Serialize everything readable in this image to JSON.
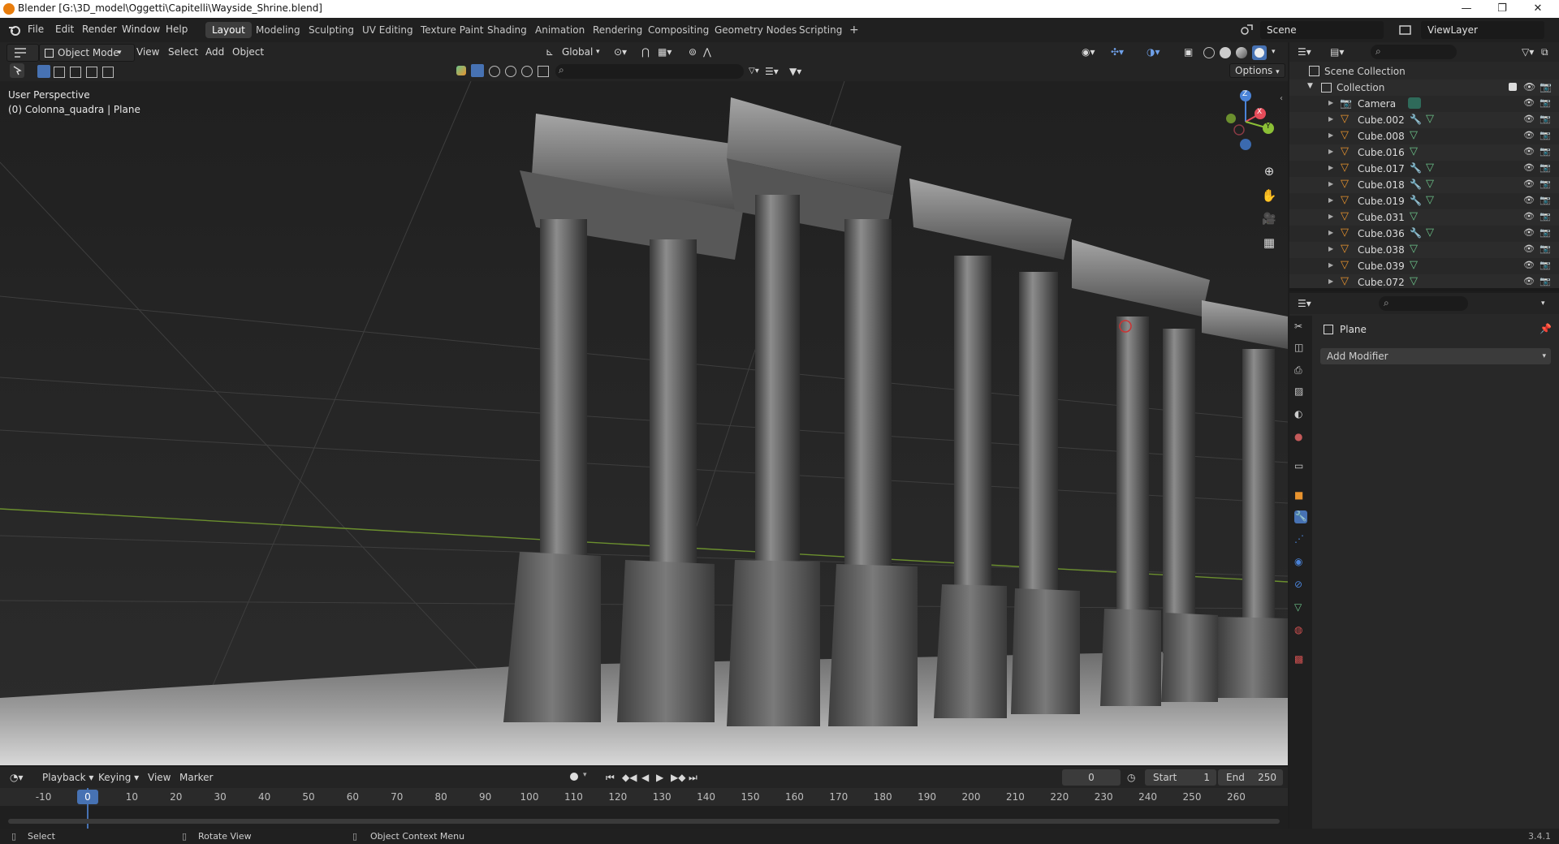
{
  "window": {
    "title": "Blender [G:\\3D_model\\Oggetti\\Capitelli\\Wayside_Shrine.blend]",
    "min_glyph": "—",
    "max_glyph": "❐",
    "close_glyph": "✕"
  },
  "menus": [
    "File",
    "Edit",
    "Render",
    "Window",
    "Help"
  ],
  "workspaces": [
    {
      "label": "Layout",
      "active": true
    },
    {
      "label": "Modeling"
    },
    {
      "label": "Sculpting"
    },
    {
      "label": "UV Editing"
    },
    {
      "label": "Texture Paint"
    },
    {
      "label": "Shading"
    },
    {
      "label": "Animation"
    },
    {
      "label": "Rendering"
    },
    {
      "label": "Compositing"
    },
    {
      "label": "Geometry Nodes"
    },
    {
      "label": "Scripting"
    }
  ],
  "add_workspace": "+",
  "scene": {
    "name": "Scene",
    "view_layer": "ViewLayer"
  },
  "viewport_header": {
    "mode": "Object Mode",
    "menus": [
      "View",
      "Select",
      "Add",
      "Object"
    ],
    "transform_orientation": "Global",
    "options": "Options"
  },
  "viewport": {
    "perspective": "User Perspective",
    "object_info": "(0) Colonna_quadra | Plane",
    "gizmo": {
      "x": "X",
      "y": "Y",
      "z": "Z"
    }
  },
  "outliner": {
    "root": "Scene Collection",
    "collection": "Collection",
    "items": [
      {
        "name": "Camera",
        "type": "camera",
        "modifier": false
      },
      {
        "name": "Cube.002",
        "type": "mesh",
        "modifier": true
      },
      {
        "name": "Cube.008",
        "type": "mesh",
        "modifier": false
      },
      {
        "name": "Cube.016",
        "type": "mesh",
        "modifier": false
      },
      {
        "name": "Cube.017",
        "type": "mesh",
        "modifier": true
      },
      {
        "name": "Cube.018",
        "type": "mesh",
        "modifier": true
      },
      {
        "name": "Cube.019",
        "type": "mesh",
        "modifier": true
      },
      {
        "name": "Cube.031",
        "type": "mesh",
        "modifier": false
      },
      {
        "name": "Cube.036",
        "type": "mesh",
        "modifier": true
      },
      {
        "name": "Cube.038",
        "type": "mesh",
        "modifier": false
      },
      {
        "name": "Cube.039",
        "type": "mesh",
        "modifier": false
      },
      {
        "name": "Cube.072",
        "type": "mesh",
        "modifier": false
      }
    ]
  },
  "properties": {
    "object_name": "Plane",
    "add_modifier": "Add Modifier"
  },
  "timeline": {
    "menus": [
      "Playback",
      "Keying",
      "View",
      "Marker"
    ],
    "current_frame": "0",
    "start_label": "Start",
    "start": "1",
    "end_label": "End",
    "end": "250",
    "ruler": [
      "-10",
      "0",
      "10",
      "20",
      "30",
      "40",
      "50",
      "60",
      "70",
      "80",
      "90",
      "100",
      "110",
      "120",
      "130",
      "140",
      "150",
      "160",
      "170",
      "180",
      "190",
      "200",
      "210",
      "220",
      "230",
      "240",
      "250",
      "260"
    ],
    "playhead": "0"
  },
  "statusbar": {
    "select": "Select",
    "rotate": "Rotate View",
    "context": "Object Context Menu",
    "version": "3.4.1"
  },
  "colors": {
    "accent": "#4772b3",
    "mesh": "#e8932e",
    "data_green": "#6cc38a",
    "x_axis": "#e64c5a",
    "y_axis": "#8bbf36",
    "z_axis": "#4a83d8"
  }
}
